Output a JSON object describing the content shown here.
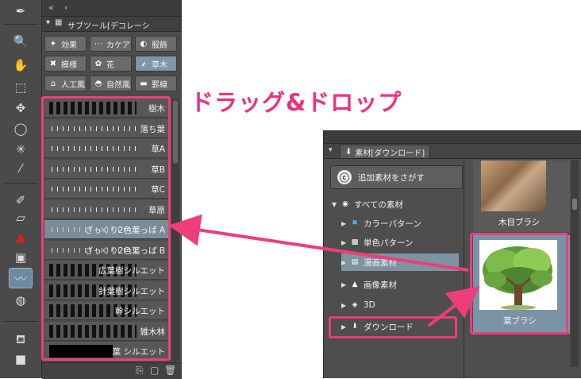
{
  "headline": "ドラッグ&ドロップ",
  "colors": {
    "accent_pink": "#ee3d7b",
    "selected_blue": "#7d96a8",
    "panel_dark": "#4b4b4b"
  },
  "tools": [
    {
      "icon": "pen-nib-icon",
      "glyph": "✒"
    },
    {
      "icon": "zoom-icon",
      "glyph": "🔍"
    },
    {
      "icon": "hand-icon",
      "glyph": "✋"
    },
    {
      "icon": "object-select-icon",
      "glyph": "⬚"
    },
    {
      "icon": "move-layer-icon",
      "glyph": "✥"
    },
    {
      "icon": "lasso-icon",
      "glyph": "◯"
    },
    {
      "icon": "magic-wand-icon",
      "glyph": "✳"
    },
    {
      "icon": "eyedropper-icon",
      "glyph": "⁄"
    },
    {
      "icon": "pen-icon",
      "glyph": "✐"
    },
    {
      "icon": "eraser-icon",
      "glyph": "▱"
    },
    {
      "icon": "airbrush-icon",
      "glyph": "▲"
    },
    {
      "icon": "fill-icon",
      "glyph": "▣"
    },
    {
      "icon": "decoration-icon",
      "glyph": "〰"
    },
    {
      "icon": "blend-icon",
      "glyph": "◍"
    },
    {
      "icon": "paint-bucket-icon",
      "glyph": "⛾"
    },
    {
      "icon": "gradient-icon",
      "glyph": "■"
    }
  ],
  "subtool": {
    "title": "サブツール[デコレーシ",
    "groups": [
      {
        "label": "効果",
        "glyph": "✦"
      },
      {
        "label": "カケア",
        "glyph": "⋯"
      },
      {
        "label": "服飾",
        "glyph": "◐"
      },
      {
        "label": "模様",
        "glyph": "✖"
      },
      {
        "label": "花",
        "glyph": "✿"
      },
      {
        "label": "草木",
        "glyph": "⸙"
      },
      {
        "label": "人工風",
        "glyph": "⌂"
      },
      {
        "label": "自然風",
        "glyph": "◓"
      },
      {
        "label": "罫線",
        "glyph": "▬"
      }
    ],
    "brushes": [
      {
        "name": "樹木"
      },
      {
        "name": "落ち葉"
      },
      {
        "name": "草A"
      },
      {
        "name": "草B"
      },
      {
        "name": "草C"
      },
      {
        "name": "草原"
      },
      {
        "name": "ざっくり2色葉っぱ A"
      },
      {
        "name": "ざっくり2色葉っぱ B"
      },
      {
        "name": "広葉樹シルエット"
      },
      {
        "name": "針葉樹シルエット"
      },
      {
        "name": "幹シルエット"
      },
      {
        "name": "雑木林"
      },
      {
        "name": "葉 シルエット"
      }
    ]
  },
  "material": {
    "tab_label": "素材[ダウンロード]",
    "search_button": "追加素材をさがす",
    "tree": [
      {
        "label": "すべての素材",
        "icon": "all-materials-icon"
      },
      {
        "label": "カラーパターン",
        "icon": "color-pattern-icon"
      },
      {
        "label": "単色パターン",
        "icon": "mono-pattern-icon"
      },
      {
        "label": "漫画素材",
        "icon": "manga-material-icon"
      },
      {
        "label": "画像素材",
        "icon": "image-material-icon"
      },
      {
        "label": "3D",
        "icon": "3d-icon"
      },
      {
        "label": "ダウンロード",
        "icon": "download-icon"
      }
    ],
    "thumbs": [
      {
        "label": "木目ブラシ"
      },
      {
        "label": "葉ブラシ"
      }
    ]
  }
}
